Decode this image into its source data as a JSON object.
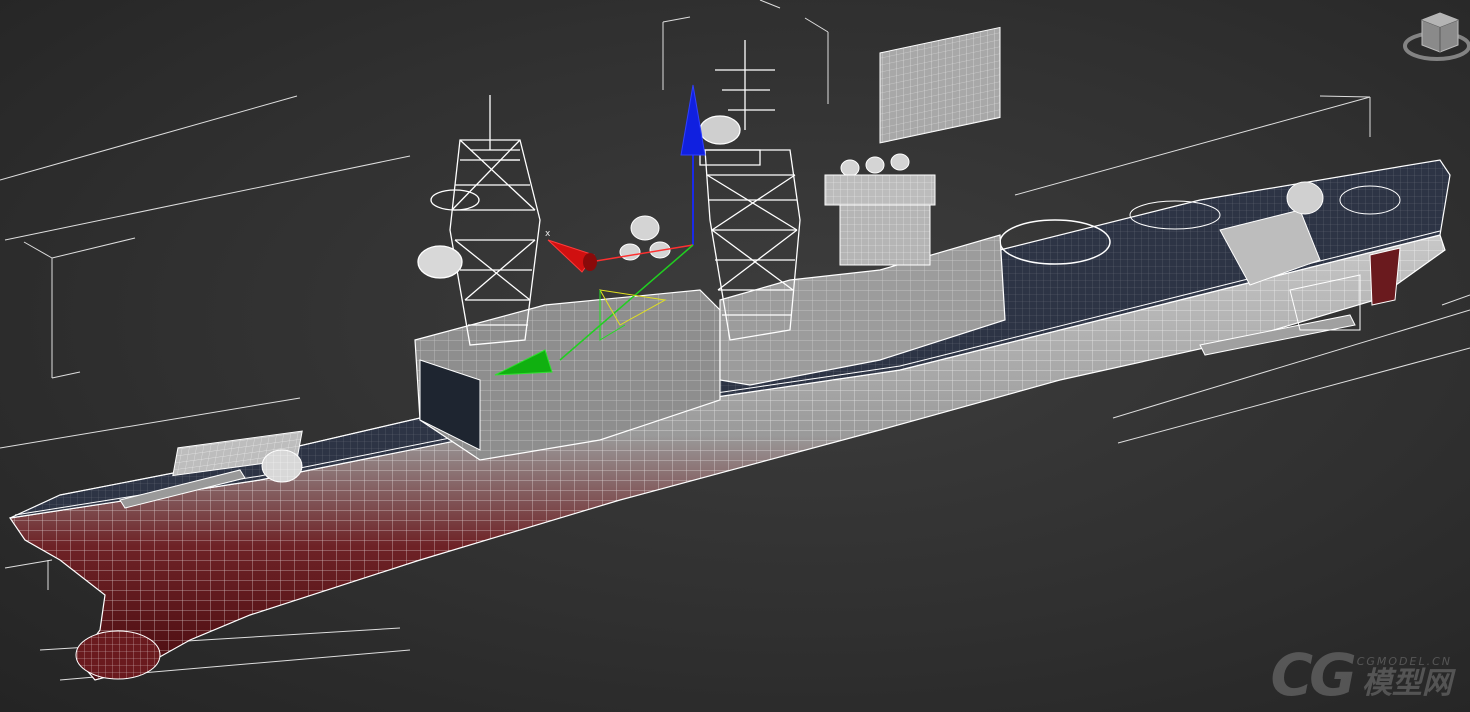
{
  "viewport": {
    "gizmo": {
      "x_axis_label": "x"
    },
    "view_cube": {
      "icon": "viewcube-icon"
    },
    "model": {
      "icon": "wireframe-ship-icon"
    },
    "watermark": {
      "logo": "CG",
      "site": "CGMODEL.CN",
      "chinese": "模型网"
    }
  },
  "colors": {
    "background": "#303030",
    "wire": "#ffffff",
    "deck": "#2d3445",
    "hull_shadow": "#5a0d12",
    "gizmo_x": "#d01010",
    "gizmo_y": "#10b010",
    "gizmo_z": "#1020e0"
  }
}
